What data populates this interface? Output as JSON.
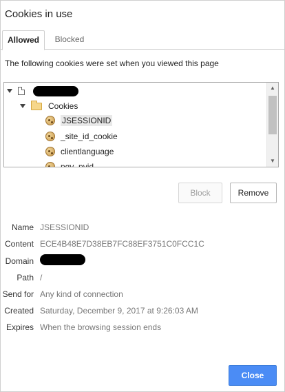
{
  "dialog": {
    "title": "Cookies in use",
    "description": "The following cookies were set when you viewed this page"
  },
  "tabs": [
    {
      "label": "Allowed",
      "active": true
    },
    {
      "label": "Blocked",
      "active": false
    }
  ],
  "tree": {
    "folder_label": "Cookies",
    "cookies": [
      "JSESSIONID",
      "_site_id_cookie",
      "clientlanguage",
      "pgv_pvid"
    ],
    "selected": "JSESSIONID"
  },
  "actions": {
    "block_label": "Block",
    "remove_label": "Remove",
    "close_label": "Close"
  },
  "details": {
    "name_label": "Name",
    "name_value": "JSESSIONID",
    "content_label": "Content",
    "content_value": "ECE4B48E7D38EB7FC88EF3751C0FCC1C",
    "domain_label": "Domain",
    "path_label": "Path",
    "path_value": "/",
    "sendfor_label": "Send for",
    "sendfor_value": "Any kind of connection",
    "created_label": "Created",
    "created_value": "Saturday, December 9, 2017 at 9:26:03 AM",
    "expires_label": "Expires",
    "expires_value": "When the browsing session ends"
  },
  "colors": {
    "accent": "#4b8cf5",
    "redaction": "#000000"
  },
  "icons": {
    "page": "page-icon",
    "folder": "folder-icon",
    "cookie": "cookie-icon"
  }
}
